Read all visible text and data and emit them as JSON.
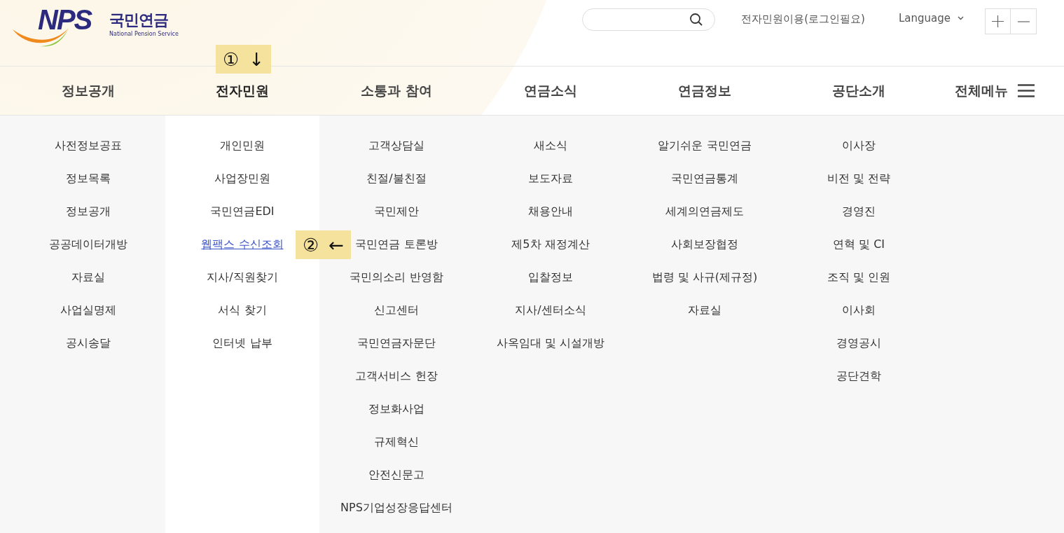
{
  "logo": {
    "mark": "NPS",
    "name": "국민연금",
    "subtitle": "National Pension Service"
  },
  "header": {
    "login_link": "전자민원이용(로그인필요)",
    "language": "Language"
  },
  "nav": {
    "items": [
      {
        "label": "정보공개",
        "selected": false
      },
      {
        "label": "전자민원",
        "selected": true
      },
      {
        "label": "소통과 참여",
        "selected": false
      },
      {
        "label": "연금소식",
        "selected": false
      },
      {
        "label": "연금정보",
        "selected": false
      },
      {
        "label": "공단소개",
        "selected": false
      }
    ],
    "all_menu": "전체메뉴"
  },
  "menu_columns": [
    {
      "items": [
        {
          "label": "사전정보공표",
          "selected": false
        },
        {
          "label": "정보목록",
          "selected": false
        },
        {
          "label": "정보공개",
          "selected": false
        },
        {
          "label": "공공데이터개방",
          "selected": false
        },
        {
          "label": "자료실",
          "selected": false
        },
        {
          "label": "사업실명제",
          "selected": false
        },
        {
          "label": "공시송달",
          "selected": false
        }
      ]
    },
    {
      "items": [
        {
          "label": "개인민원",
          "selected": false
        },
        {
          "label": "사업장민원",
          "selected": false
        },
        {
          "label": "국민연금EDI",
          "selected": false
        },
        {
          "label": "웹팩스 수신조회",
          "selected": true
        },
        {
          "label": "지사/직원찾기",
          "selected": false
        },
        {
          "label": "서식 찾기",
          "selected": false
        },
        {
          "label": "인터넷 납부",
          "selected": false
        }
      ]
    },
    {
      "items": [
        {
          "label": "고객상담실",
          "selected": false
        },
        {
          "label": "친절/불친절",
          "selected": false
        },
        {
          "label": "국민제안",
          "selected": false
        },
        {
          "label": "국민연금 토론방",
          "selected": false
        },
        {
          "label": "국민의소리 반영함",
          "selected": false
        },
        {
          "label": "신고센터",
          "selected": false
        },
        {
          "label": "국민연금자문단",
          "selected": false
        },
        {
          "label": "고객서비스 헌장",
          "selected": false
        },
        {
          "label": "정보화사업",
          "selected": false
        },
        {
          "label": "규제혁신",
          "selected": false
        },
        {
          "label": "안전신문고",
          "selected": false
        },
        {
          "label": "NPS기업성장응답센터",
          "selected": false
        }
      ]
    },
    {
      "items": [
        {
          "label": "새소식",
          "selected": false
        },
        {
          "label": "보도자료",
          "selected": false
        },
        {
          "label": "채용안내",
          "selected": false
        },
        {
          "label": "제5차 재정계산",
          "selected": false
        },
        {
          "label": "입찰정보",
          "selected": false
        },
        {
          "label": "지사/센터소식",
          "selected": false
        },
        {
          "label": "사옥임대 및 시설개방",
          "selected": false
        }
      ]
    },
    {
      "items": [
        {
          "label": "알기쉬운 국민연금",
          "selected": false
        },
        {
          "label": "국민연금통계",
          "selected": false
        },
        {
          "label": "세계의연금제도",
          "selected": false
        },
        {
          "label": "사회보장협정",
          "selected": false
        },
        {
          "label": "법령 및 사규(제규정)",
          "selected": false
        },
        {
          "label": "자료실",
          "selected": false
        }
      ]
    },
    {
      "items": [
        {
          "label": "이사장",
          "selected": false
        },
        {
          "label": "비전 및 전략",
          "selected": false
        },
        {
          "label": "경영진",
          "selected": false
        },
        {
          "label": "연혁 및 CI",
          "selected": false
        },
        {
          "label": "조직 및 인원",
          "selected": false
        },
        {
          "label": "이사회",
          "selected": false
        },
        {
          "label": "경영공시",
          "selected": false
        },
        {
          "label": "공단견학",
          "selected": false
        }
      ]
    }
  ],
  "annotations": [
    {
      "number": "①",
      "arrow": "↓"
    },
    {
      "number": "②",
      "arrow": "←"
    }
  ]
}
